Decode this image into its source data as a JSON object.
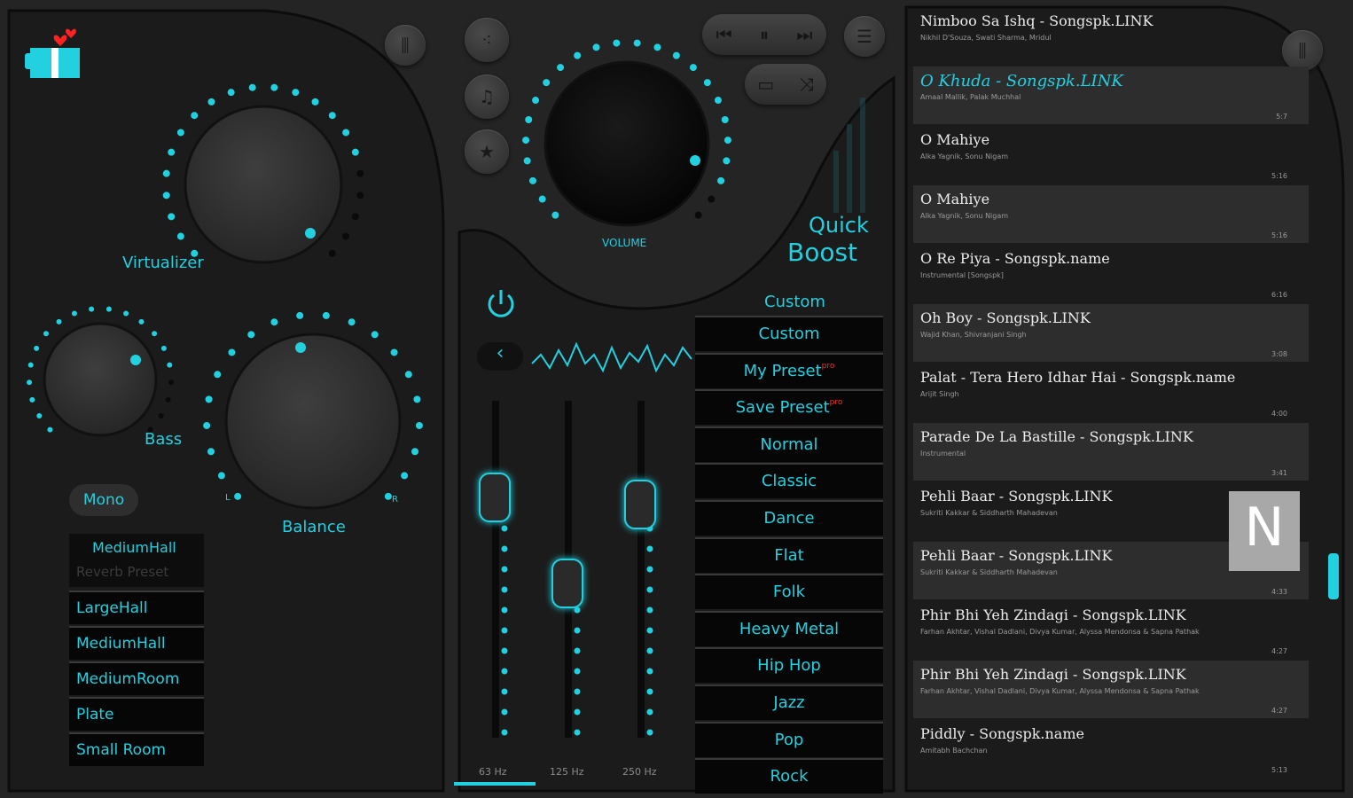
{
  "app": {
    "accent": "#22d0e0",
    "logo_icon": "gift-hearts-icon"
  },
  "effects": {
    "virtualizer_label": "Virtualizer",
    "bass_label": "Bass",
    "balance_label": "Balance",
    "balance_left": "L",
    "balance_right": "R",
    "mono_label": "Mono",
    "reverb": {
      "selected": "MediumHall",
      "hint": "Reverb Preset",
      "options": [
        "LargeHall",
        "MediumHall",
        "MediumRoom",
        "Plate",
        "Small Room"
      ]
    }
  },
  "player": {
    "volume_label": "VOLUME",
    "quick_boost_line1": "Quick",
    "quick_boost_line2": "Boost",
    "icons": [
      "equalizer-icon",
      "share-icon",
      "music-note-icon",
      "star-icon",
      "previous-icon",
      "pause-icon",
      "next-icon",
      "playlist-icon",
      "repeat-icon",
      "shuffle-icon",
      "power-icon",
      "back-chevron-icon"
    ]
  },
  "equalizer": {
    "bands": [
      "63 Hz",
      "125 Hz",
      "250 Hz"
    ],
    "current_preset": "Custom",
    "presets": [
      {
        "name": "Custom",
        "pro": ""
      },
      {
        "name": "My Preset",
        "pro": "pro"
      },
      {
        "name": "Save Preset",
        "pro": "pro"
      },
      {
        "name": "Normal",
        "pro": ""
      },
      {
        "name": "Classic",
        "pro": ""
      },
      {
        "name": "Dance",
        "pro": ""
      },
      {
        "name": "Flat",
        "pro": ""
      },
      {
        "name": "Folk",
        "pro": ""
      },
      {
        "name": "Heavy Metal",
        "pro": ""
      },
      {
        "name": "Hip Hop",
        "pro": ""
      },
      {
        "name": "Jazz",
        "pro": ""
      },
      {
        "name": "Pop",
        "pro": ""
      },
      {
        "name": "Rock",
        "pro": ""
      }
    ]
  },
  "playlist": {
    "scroll_letter": "N",
    "songs": [
      {
        "title": "Nimboo Sa Ishq - Songspk.LINK",
        "artist": "Nikhil D'Souza, Swati Sharma, Mridul",
        "duration": "",
        "active": false
      },
      {
        "title": "O Khuda - Songspk.LINK",
        "artist": "Amaal Mallik, Palak Muchhal",
        "duration": "5:7",
        "active": true
      },
      {
        "title": "O Mahiye",
        "artist": "Alka Yagnik, Sonu Nigam",
        "duration": "5:16",
        "active": false
      },
      {
        "title": "O Mahiye",
        "artist": "Alka Yagnik, Sonu Nigam",
        "duration": "5:16",
        "active": false
      },
      {
        "title": "O Re Piya - Songspk.name",
        "artist": "Instrumental [Songspk]",
        "duration": "6:16",
        "active": false
      },
      {
        "title": "Oh Boy - Songspk.LINK",
        "artist": "Wajid Khan, Shivranjani Singh",
        "duration": "3:08",
        "active": false
      },
      {
        "title": "Palat - Tera Hero Idhar Hai - Songspk.name",
        "artist": "Arijit Singh",
        "duration": "4:00",
        "active": false
      },
      {
        "title": "Parade De La Bastille - Songspk.LINK",
        "artist": "Instrumental",
        "duration": "3:41",
        "active": false
      },
      {
        "title": "Pehli Baar - Songspk.LINK",
        "artist": "Sukriti Kakkar & Siddharth Mahadevan",
        "duration": "",
        "active": false
      },
      {
        "title": "Pehli Baar - Songspk.LINK",
        "artist": "Sukriti Kakkar & Siddharth Mahadevan",
        "duration": "4:33",
        "active": false
      },
      {
        "title": "Phir Bhi Yeh Zindagi - Songspk.LINK",
        "artist": "Farhan Akhtar, Vishal Dadlani, Divya Kumar, Alyssa Mendonsa & Sapna Pathak",
        "duration": "4:27",
        "active": false
      },
      {
        "title": "Phir Bhi Yeh Zindagi - Songspk.LINK",
        "artist": "Farhan Akhtar, Vishal Dadlani, Divya Kumar, Alyssa Mendonsa & Sapna Pathak",
        "duration": "4:27",
        "active": false
      },
      {
        "title": "Piddly - Songspk.name",
        "artist": "Amitabh Bachchan",
        "duration": "5:13",
        "active": false
      }
    ]
  }
}
